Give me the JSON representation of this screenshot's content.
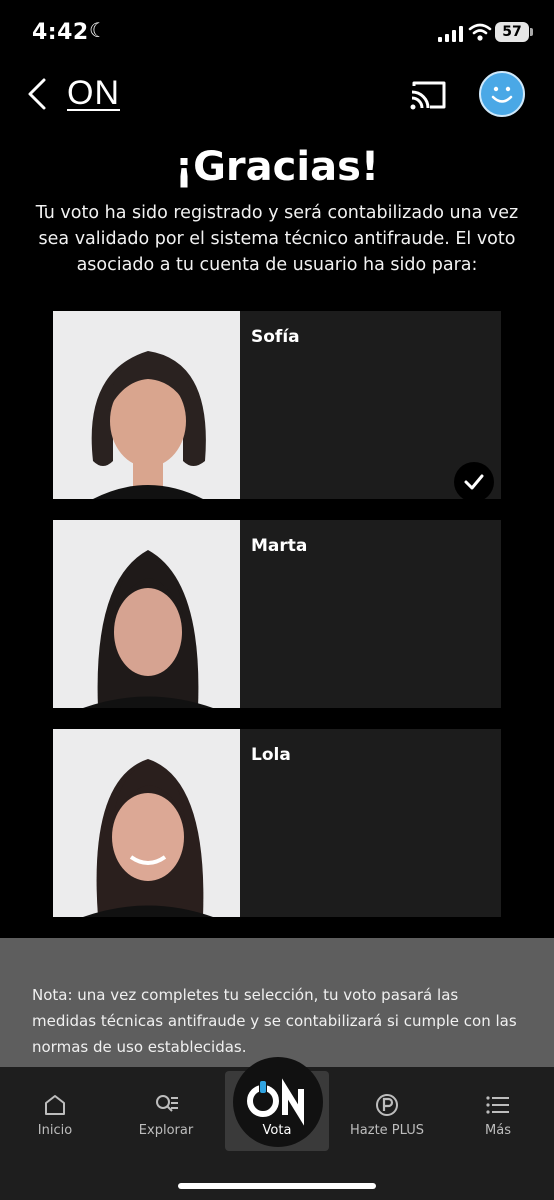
{
  "status_bar": {
    "time": "4:42",
    "battery": "57"
  },
  "header": {
    "brand": "ON"
  },
  "title": "¡Gracias!",
  "description": "Tu voto ha sido registrado y será contabilizado una vez sea validado por el sistema técnico antifraude. El voto asociado a tu cuenta de usuario ha sido para:",
  "candidates": [
    {
      "name": "Sofía",
      "selected": true
    },
    {
      "name": "Marta",
      "selected": false
    },
    {
      "name": "Lola",
      "selected": false
    }
  ],
  "note": "Nota: una vez completes tu selección, tu voto pasará las medidas técnicas antifraude y se contabilizará si cumple con las normas de uso establecidas.",
  "tabs": [
    {
      "label": "Inicio",
      "icon": "home-icon"
    },
    {
      "label": "Explorar",
      "icon": "explore-icon"
    },
    {
      "label": "Vota",
      "icon": "on-logo-icon",
      "active": true
    },
    {
      "label": "Hazte PLUS",
      "icon": "plus-icon"
    },
    {
      "label": "Más",
      "icon": "menu-icon"
    }
  ],
  "colors": {
    "background": "#000000",
    "card": "#1c1c1c",
    "note_bg": "#5e5e5e",
    "avatar": "#4aa8e6",
    "tabbar": "#1e1e1e"
  }
}
